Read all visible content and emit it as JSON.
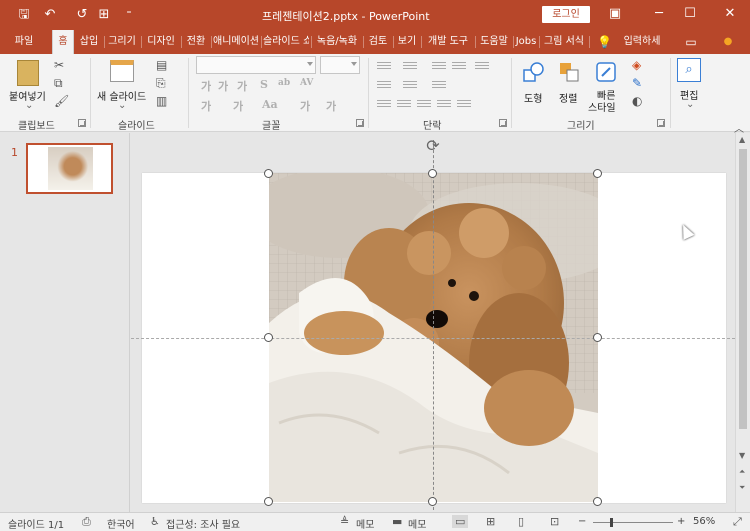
{
  "titlebar": {
    "title": "프레젠테이션2.pptx  -  PowerPoint",
    "login": "로그인",
    "qa_icons": [
      "save-icon",
      "undo-icon",
      "redo-icon",
      "present-icon",
      "customize-icon"
    ],
    "qa_glyphs": [
      "🖫",
      "↶",
      "↺",
      "⊞",
      "⁼"
    ],
    "window_glyphs": [
      "▣",
      "─",
      "☐",
      "✕"
    ]
  },
  "tabs": [
    "파일",
    "홈",
    "삽입",
    "그리기",
    "디자인",
    "전환",
    "애니메이션",
    "슬라이드 쇼",
    "녹음/녹화",
    "검토",
    "보기",
    "개발 도구",
    "도움말",
    "Jobs",
    "그림 서식"
  ],
  "search": {
    "label": "입력하세",
    "icon": "💡"
  },
  "ribbon": {
    "clipboard": {
      "label": "클립보드",
      "paste": "붙여넣기"
    },
    "slides": {
      "label": "슬라이드",
      "new_slide": "새 슬라이드"
    },
    "font": {
      "label": "글꼴",
      "fmt": [
        "가",
        "가",
        "가",
        "S",
        "ab",
        "AV",
        "가",
        "가",
        "Aa",
        "가",
        "가"
      ]
    },
    "paragraph": {
      "label": "단락"
    },
    "drawing": {
      "label": "그리기",
      "shapes": "도형",
      "arrange": "정렬",
      "quick_styles_1": "빠른",
      "quick_styles_2": "스타일"
    },
    "editing": {
      "label": "편집"
    }
  },
  "thumbnail": {
    "number": "1"
  },
  "statusbar": {
    "slide": "슬라이드 1/1",
    "language": "한국어",
    "accessibility": "접근성: 조사 필요",
    "notes": "메모",
    "comments": "메모",
    "zoom": "56%",
    "zoom_minus": "−",
    "zoom_plus": "+"
  },
  "colors": {
    "accent": "#b7472a"
  }
}
